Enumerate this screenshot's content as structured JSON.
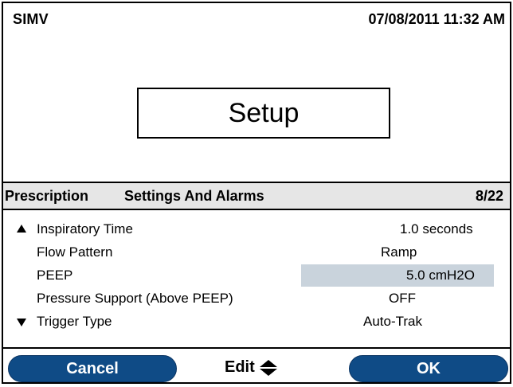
{
  "status": {
    "mode": "SIMV",
    "datetime": "07/08/2011 11:32 AM"
  },
  "screen": {
    "title": "Setup"
  },
  "section": {
    "tab_prescription": "Prescription",
    "tab_settings": "Settings And Alarms",
    "page": "8/22"
  },
  "rows": [
    {
      "label": "Inspiratory Time",
      "value": "1.0 seconds",
      "arrow": "up-arrow-icon"
    },
    {
      "label": "Flow Pattern",
      "value": "Ramp"
    },
    {
      "label": "PEEP",
      "value": "5.0 cmH2O",
      "selected": true
    },
    {
      "label": "Pressure Support (Above PEEP)",
      "value": "OFF"
    },
    {
      "label": "Trigger Type",
      "value": "Auto-Trak",
      "arrow": "down-arrow-icon"
    }
  ],
  "buttons": {
    "cancel": "Cancel",
    "edit": "Edit",
    "ok": "OK"
  },
  "colors": {
    "button_blue": "#0f4b86",
    "header_gray": "#e6e6e6",
    "selection_highlight": "#c9d3dc"
  }
}
